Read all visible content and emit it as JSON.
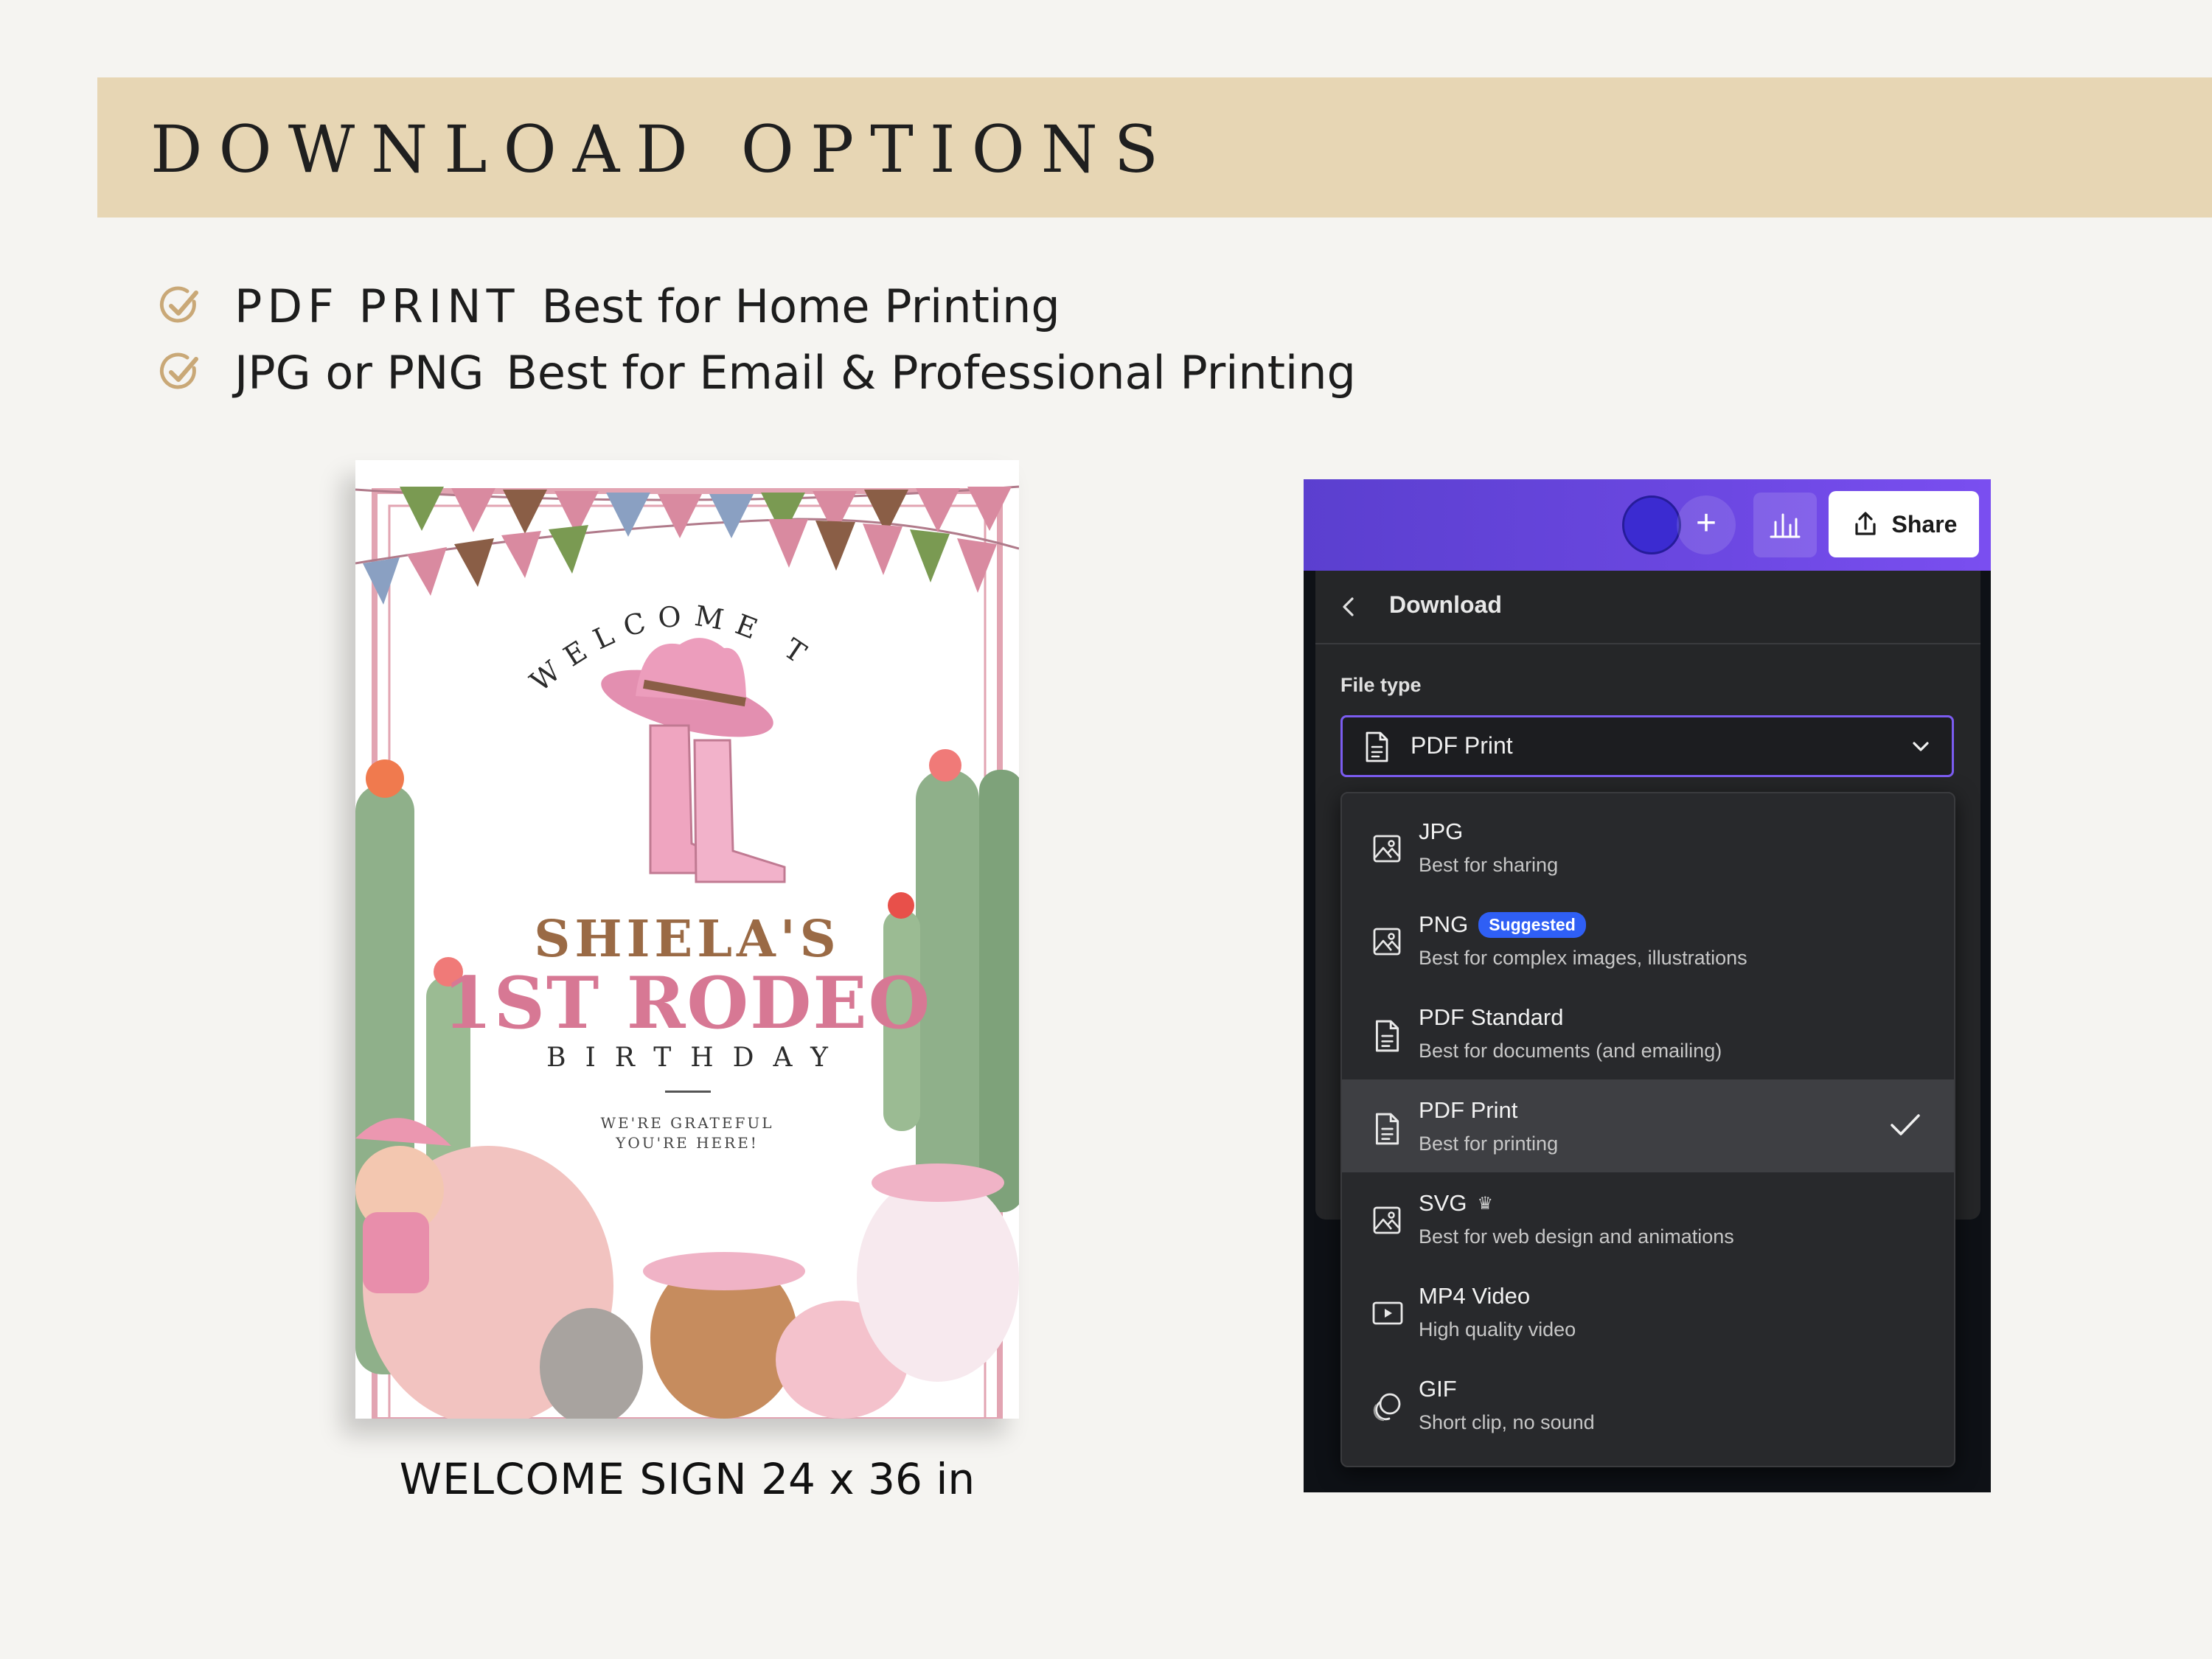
{
  "banner": {
    "title": "DOWNLOAD OPTIONS"
  },
  "features": [
    {
      "strong": "PDF PRINT",
      "text": "Best for Home Printing"
    },
    {
      "strong": "JPG or PNG",
      "text": "Best for Email & Professional Printing"
    }
  ],
  "poster": {
    "welcome": "WELCOME TO",
    "name": "SHIELA'S",
    "event": "1ST RODEO",
    "subtitle": "BIRTHDAY",
    "grateful_line1": "WE'RE GRATEFUL",
    "grateful_line2": "YOU'RE HERE!"
  },
  "caption": {
    "strong": "WELCOME SIGN",
    "size": "24 x 36 in"
  },
  "ui": {
    "accent": "#7b5cf0",
    "topbar": {
      "share_label": "Share"
    },
    "download": {
      "title": "Download",
      "file_type_label": "File type",
      "selected_value": "PDF Print",
      "options": [
        {
          "title": "JPG",
          "desc": "Best for sharing",
          "icon": "image-icon",
          "badge": "",
          "selected": false
        },
        {
          "title": "PNG",
          "desc": "Best for complex images, illustrations",
          "icon": "image-icon",
          "badge": "Suggested",
          "selected": false
        },
        {
          "title": "PDF Standard",
          "desc": "Best for documents (and emailing)",
          "icon": "document-icon",
          "badge": "",
          "selected": false
        },
        {
          "title": "PDF Print",
          "desc": "Best for printing",
          "icon": "document-icon",
          "badge": "",
          "selected": true
        },
        {
          "title": "SVG",
          "desc": "Best for web design and animations",
          "icon": "image-icon",
          "badge": "",
          "selected": false
        },
        {
          "title": "MP4 Video",
          "desc": "High quality video",
          "icon": "video-icon",
          "badge": "",
          "selected": false
        },
        {
          "title": "GIF",
          "desc": "Short clip, no sound",
          "icon": "gif-icon",
          "badge": "",
          "selected": false
        }
      ]
    }
  }
}
